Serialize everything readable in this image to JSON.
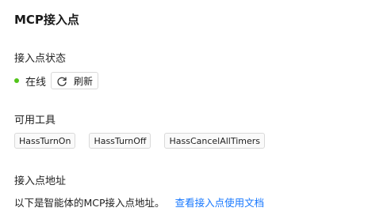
{
  "page": {
    "title": "MCP接入点"
  },
  "status_section": {
    "title": "接入点状态",
    "status_text": "在线",
    "status_color": "#52c41a",
    "refresh_icon": "refresh-icon",
    "refresh_label": "刷新"
  },
  "tools_section": {
    "title": "可用工具",
    "tools": [
      "HassTurnOn",
      "HassTurnOff",
      "HassCancelAllTimers"
    ]
  },
  "address_section": {
    "title": "接入点地址",
    "description": "以下是智能体的MCP接入点地址。",
    "docs_link": "查看接入点使用文档",
    "link_color": "#1677ff"
  }
}
